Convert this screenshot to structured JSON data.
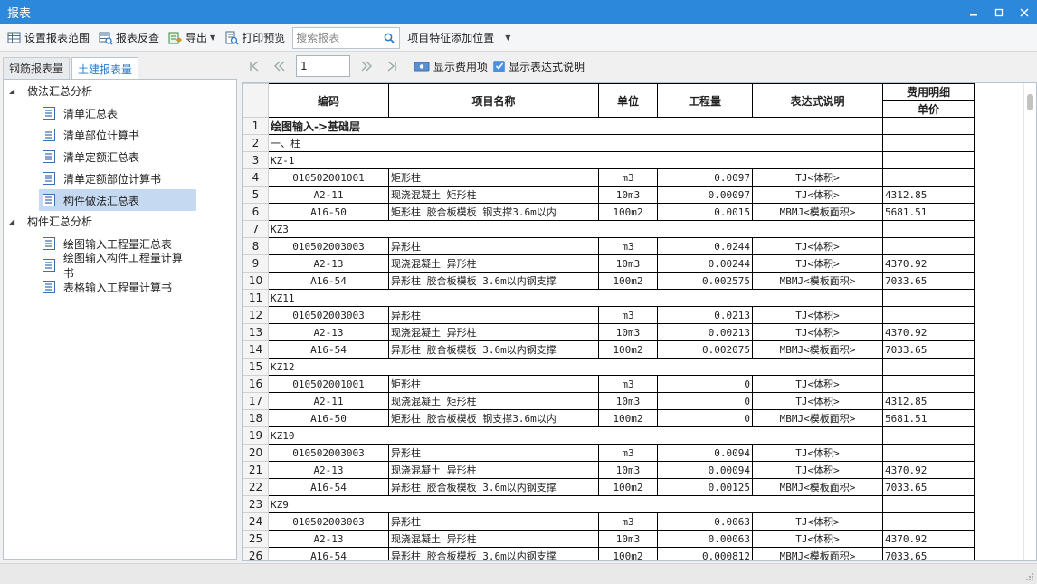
{
  "window": {
    "title": "报表"
  },
  "toolbar": {
    "set_range": "设置报表范围",
    "reverse_check": "报表反查",
    "export": "导出",
    "print_preview": "打印预览",
    "search_placeholder": "搜索报表",
    "feature_position": "项目特征添加位置"
  },
  "tabs": [
    {
      "label": "钢筋报表量"
    },
    {
      "label": "土建报表量"
    }
  ],
  "tree": {
    "group1": "做法汇总分析",
    "group1_items": [
      "清单汇总表",
      "清单部位计算书",
      "清单定额汇总表",
      "清单定额部位计算书",
      "构件做法汇总表"
    ],
    "group2": "构件汇总分析",
    "group2_items": [
      "绘图输入工程量汇总表",
      "绘图输入构件工程量计算书",
      "表格输入工程量计算书"
    ]
  },
  "nav": {
    "page": "1",
    "show_fee": "显示费用项",
    "show_expr": "显示表达式说明"
  },
  "table": {
    "headers": {
      "code": "编码",
      "name": "项目名称",
      "unit": "单位",
      "qty": "工程量",
      "expr": "表达式说明",
      "fee": "费用明细",
      "price": "单价"
    },
    "rows": [
      {
        "n": "1",
        "type": "section",
        "text": "绘图输入->基础层"
      },
      {
        "n": "2",
        "type": "group",
        "text": "一、柱"
      },
      {
        "n": "3",
        "type": "group",
        "text": "KZ-1"
      },
      {
        "n": "4",
        "code": "010502001001",
        "name": "矩形柱",
        "unit": "m3",
        "qty": "0.0097",
        "expr": "TJ<体积>",
        "price": ""
      },
      {
        "n": "5",
        "code": "A2-11",
        "name": "现浇混凝土 矩形柱",
        "unit": "10m3",
        "qty": "0.00097",
        "expr": "TJ<体积>",
        "price": "4312.85"
      },
      {
        "n": "6",
        "code": "A16-50",
        "name": "矩形柱 胶合板模板 钢支撑3.6m以内",
        "unit": "100m2",
        "qty": "0.0015",
        "expr": "MBMJ<模板面积>",
        "price": "5681.51"
      },
      {
        "n": "7",
        "type": "group",
        "text": "KZ3"
      },
      {
        "n": "8",
        "code": "010502003003",
        "name": "异形柱",
        "unit": "m3",
        "qty": "0.0244",
        "expr": "TJ<体积>",
        "price": ""
      },
      {
        "n": "9",
        "code": "A2-13",
        "name": "现浇混凝土 异形柱",
        "unit": "10m3",
        "qty": "0.00244",
        "expr": "TJ<体积>",
        "price": "4370.92"
      },
      {
        "n": "10",
        "code": "A16-54",
        "name": "异形柱 胶合板模板 3.6m以内钢支撑",
        "unit": "100m2",
        "qty": "0.002575",
        "expr": "MBMJ<模板面积>",
        "price": "7033.65"
      },
      {
        "n": "11",
        "type": "group",
        "text": "KZ11"
      },
      {
        "n": "12",
        "code": "010502003003",
        "name": "异形柱",
        "unit": "m3",
        "qty": "0.0213",
        "expr": "TJ<体积>",
        "price": ""
      },
      {
        "n": "13",
        "code": "A2-13",
        "name": "现浇混凝土 异形柱",
        "unit": "10m3",
        "qty": "0.00213",
        "expr": "TJ<体积>",
        "price": "4370.92"
      },
      {
        "n": "14",
        "code": "A16-54",
        "name": "异形柱 胶合板模板 3.6m以内钢支撑",
        "unit": "100m2",
        "qty": "0.002075",
        "expr": "MBMJ<模板面积>",
        "price": "7033.65"
      },
      {
        "n": "15",
        "type": "group",
        "text": "KZ12"
      },
      {
        "n": "16",
        "code": "010502001001",
        "name": "矩形柱",
        "unit": "m3",
        "qty": "0",
        "expr": "TJ<体积>",
        "price": ""
      },
      {
        "n": "17",
        "code": "A2-11",
        "name": "现浇混凝土 矩形柱",
        "unit": "10m3",
        "qty": "0",
        "expr": "TJ<体积>",
        "price": "4312.85"
      },
      {
        "n": "18",
        "code": "A16-50",
        "name": "矩形柱 胶合板模板 钢支撑3.6m以内",
        "unit": "100m2",
        "qty": "0",
        "expr": "MBMJ<模板面积>",
        "price": "5681.51"
      },
      {
        "n": "19",
        "type": "group",
        "text": "KZ10"
      },
      {
        "n": "20",
        "code": "010502003003",
        "name": "异形柱",
        "unit": "m3",
        "qty": "0.0094",
        "expr": "TJ<体积>",
        "price": ""
      },
      {
        "n": "21",
        "code": "A2-13",
        "name": "现浇混凝土 异形柱",
        "unit": "10m3",
        "qty": "0.00094",
        "expr": "TJ<体积>",
        "price": "4370.92"
      },
      {
        "n": "22",
        "code": "A16-54",
        "name": "异形柱 胶合板模板 3.6m以内钢支撑",
        "unit": "100m2",
        "qty": "0.00125",
        "expr": "MBMJ<模板面积>",
        "price": "7033.65"
      },
      {
        "n": "23",
        "type": "group",
        "text": "KZ9"
      },
      {
        "n": "24",
        "code": "010502003003",
        "name": "异形柱",
        "unit": "m3",
        "qty": "0.0063",
        "expr": "TJ<体积>",
        "price": ""
      },
      {
        "n": "25",
        "code": "A2-13",
        "name": "现浇混凝土 异形柱",
        "unit": "10m3",
        "qty": "0.00063",
        "expr": "TJ<体积>",
        "price": "4370.92"
      },
      {
        "n": "26",
        "code": "A16-54",
        "name": "异形柱 胶合板模板 3.6m以内钢支撑",
        "unit": "100m2",
        "qty": "0.000812",
        "expr": "MBMJ<模板面积>",
        "price": "7033.65"
      }
    ]
  }
}
